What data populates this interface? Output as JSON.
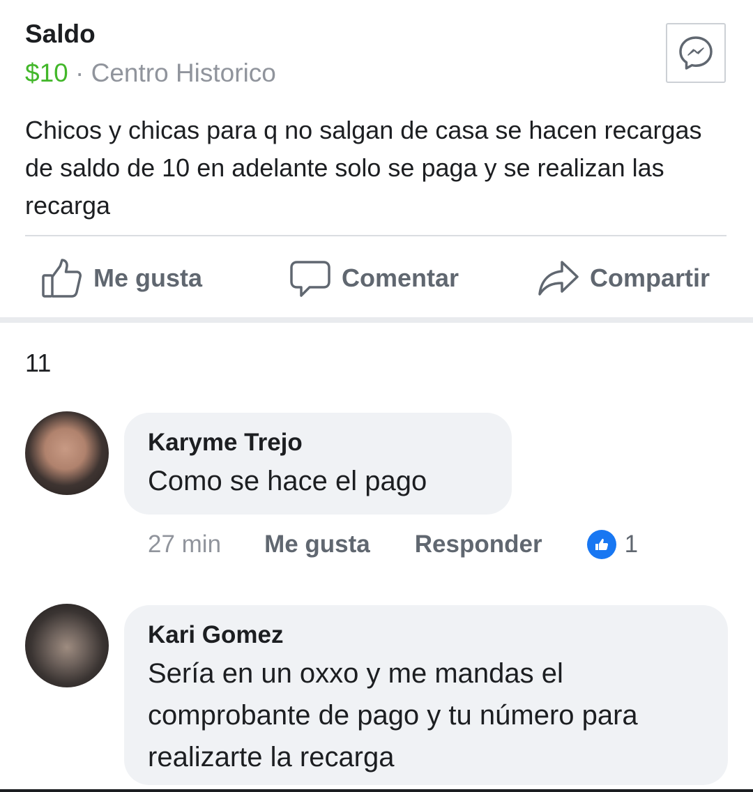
{
  "listing": {
    "title": "Saldo",
    "price": "$10",
    "separator": " · ",
    "location": "Centro Historico",
    "description": "Chicos y chicas para q no salgan de casa se hacen recargas de saldo de 10 en adelante solo se paga y se realizan las recarga"
  },
  "actions": {
    "like": "Me gusta",
    "comment": "Comentar",
    "share": "Compartir"
  },
  "comments_count": "11",
  "comments": [
    {
      "author": "Karyme Trejo",
      "text": "Como se hace el pago",
      "time": "27 min",
      "like_label": "Me gusta",
      "reply_label": "Responder",
      "reactions": "1"
    },
    {
      "author": "Kari Gomez",
      "text": "Sería en un oxxo y me mandas el comprobante de pago y tu número para realizarte la recarga"
    }
  ],
  "icons": {
    "messenger": "messenger-icon",
    "like": "thumbs-up-icon",
    "comment": "speech-bubble-icon",
    "share": "share-arrow-icon",
    "reaction": "like-reaction-icon"
  },
  "colors": {
    "price": "#42b72a",
    "muted": "#90949c",
    "action": "#606770",
    "bubble": "#f0f2f5",
    "reaction": "#1877f2"
  }
}
